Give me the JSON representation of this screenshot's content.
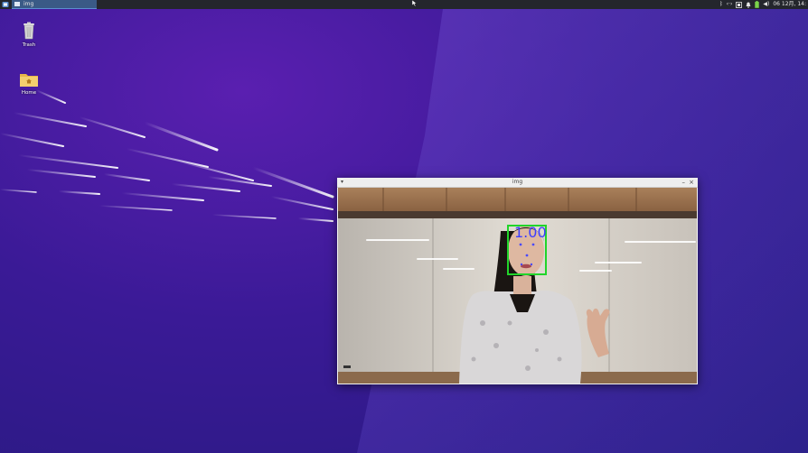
{
  "taskbar": {
    "menu_icon": "app-menu-icon",
    "task_label": "img",
    "clock": "06 12月, 14:"
  },
  "tray": {
    "bluetooth": "ᛒ",
    "network": "‹·›",
    "volume": "◀)",
    "icons": [
      "bluetooth-icon",
      "network-icon",
      "screen-icon",
      "notification-icon",
      "battery-icon",
      "volume-icon"
    ]
  },
  "desktop": {
    "icons": [
      {
        "label": "Trash",
        "icon": "trash-icon"
      },
      {
        "label": "Home",
        "icon": "home-folder-icon"
      }
    ]
  },
  "window": {
    "title": "img",
    "menu_glyph": "▾",
    "minimize_glyph": "–",
    "close_glyph": "×"
  },
  "detection": {
    "score": "1.00",
    "box_color": "#21d42a",
    "text_color": "#3d3dff"
  },
  "colors": {
    "panel": "#24262c",
    "task_active": "#3a5a86",
    "desktop_base": "#3a1a96"
  }
}
